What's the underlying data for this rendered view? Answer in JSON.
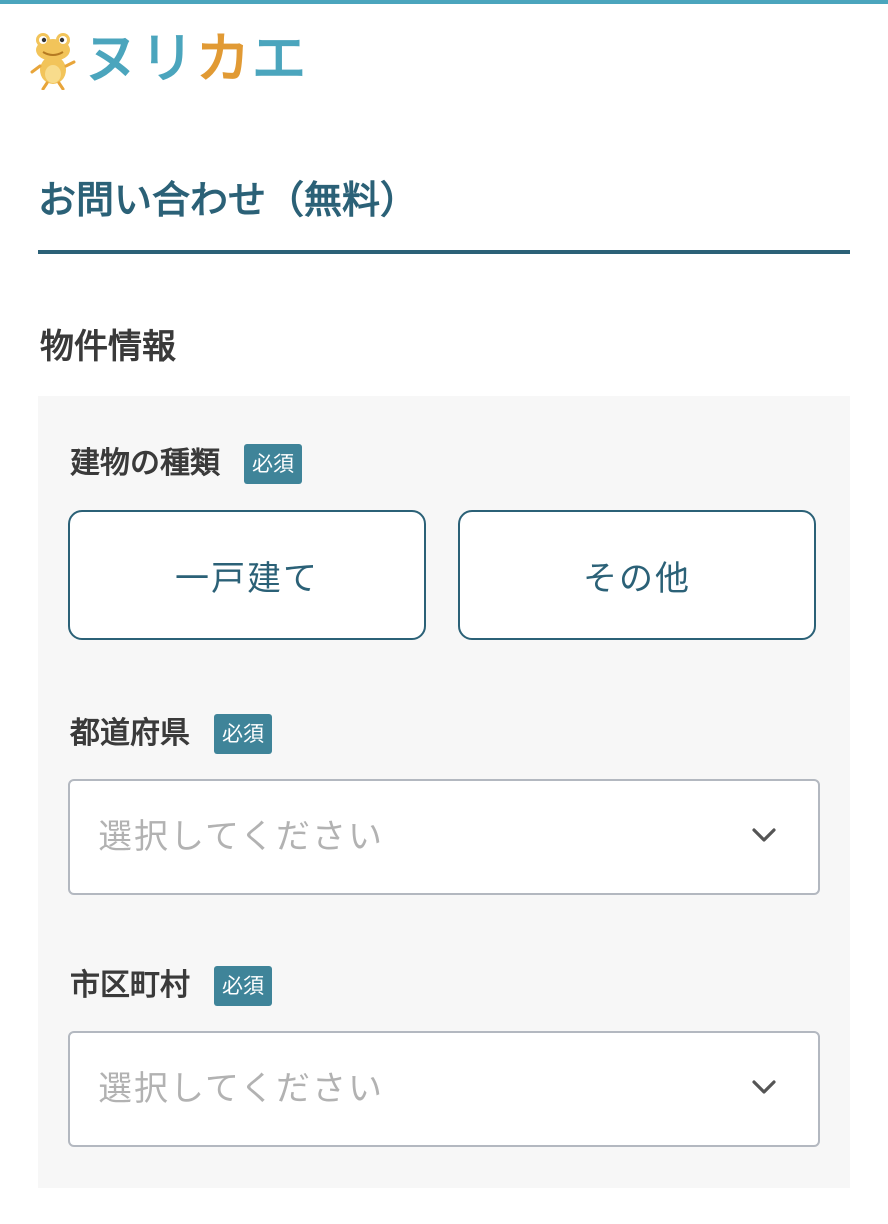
{
  "brand": {
    "logo_chars": [
      "ヌ",
      "リ",
      "カ",
      "エ"
    ],
    "logo_colors": [
      "#4ba5bd",
      "#4ba5bd",
      "#e19a34",
      "#4ba5bd"
    ],
    "mascot_icon": "frog-mascot-icon"
  },
  "page": {
    "title": "お問い合わせ（無料）",
    "accent_color": "#2b6177"
  },
  "section": {
    "title": "物件情報"
  },
  "form": {
    "building_type": {
      "label": "建物の種類",
      "required": "必須",
      "options": [
        "一戸建て",
        "その他"
      ]
    },
    "prefecture": {
      "label": "都道府県",
      "required": "必須",
      "placeholder": "選択してください",
      "icon": "chevron-down-icon"
    },
    "city": {
      "label": "市区町村",
      "required": "必須",
      "placeholder": "選択してください",
      "icon": "chevron-down-icon"
    }
  }
}
